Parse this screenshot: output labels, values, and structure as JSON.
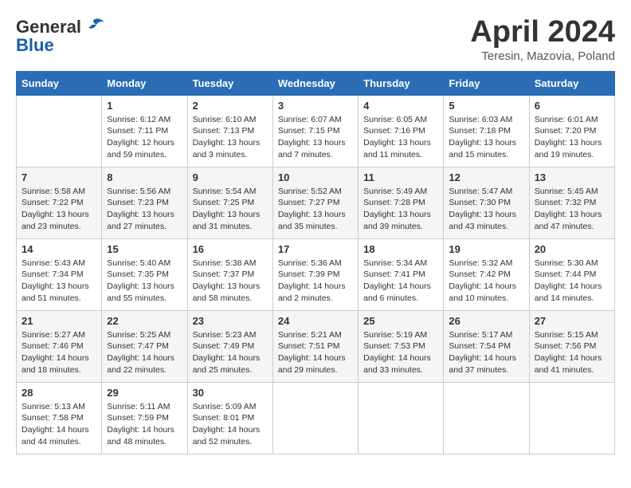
{
  "header": {
    "logo_line1": "General",
    "logo_line2": "Blue",
    "month_year": "April 2024",
    "location": "Teresin, Mazovia, Poland"
  },
  "days_of_week": [
    "Sunday",
    "Monday",
    "Tuesday",
    "Wednesday",
    "Thursday",
    "Friday",
    "Saturday"
  ],
  "weeks": [
    [
      {
        "day": "",
        "info": ""
      },
      {
        "day": "1",
        "info": "Sunrise: 6:12 AM\nSunset: 7:11 PM\nDaylight: 12 hours\nand 59 minutes."
      },
      {
        "day": "2",
        "info": "Sunrise: 6:10 AM\nSunset: 7:13 PM\nDaylight: 13 hours\nand 3 minutes."
      },
      {
        "day": "3",
        "info": "Sunrise: 6:07 AM\nSunset: 7:15 PM\nDaylight: 13 hours\nand 7 minutes."
      },
      {
        "day": "4",
        "info": "Sunrise: 6:05 AM\nSunset: 7:16 PM\nDaylight: 13 hours\nand 11 minutes."
      },
      {
        "day": "5",
        "info": "Sunrise: 6:03 AM\nSunset: 7:18 PM\nDaylight: 13 hours\nand 15 minutes."
      },
      {
        "day": "6",
        "info": "Sunrise: 6:01 AM\nSunset: 7:20 PM\nDaylight: 13 hours\nand 19 minutes."
      }
    ],
    [
      {
        "day": "7",
        "info": "Sunrise: 5:58 AM\nSunset: 7:22 PM\nDaylight: 13 hours\nand 23 minutes."
      },
      {
        "day": "8",
        "info": "Sunrise: 5:56 AM\nSunset: 7:23 PM\nDaylight: 13 hours\nand 27 minutes."
      },
      {
        "day": "9",
        "info": "Sunrise: 5:54 AM\nSunset: 7:25 PM\nDaylight: 13 hours\nand 31 minutes."
      },
      {
        "day": "10",
        "info": "Sunrise: 5:52 AM\nSunset: 7:27 PM\nDaylight: 13 hours\nand 35 minutes."
      },
      {
        "day": "11",
        "info": "Sunrise: 5:49 AM\nSunset: 7:28 PM\nDaylight: 13 hours\nand 39 minutes."
      },
      {
        "day": "12",
        "info": "Sunrise: 5:47 AM\nSunset: 7:30 PM\nDaylight: 13 hours\nand 43 minutes."
      },
      {
        "day": "13",
        "info": "Sunrise: 5:45 AM\nSunset: 7:32 PM\nDaylight: 13 hours\nand 47 minutes."
      }
    ],
    [
      {
        "day": "14",
        "info": "Sunrise: 5:43 AM\nSunset: 7:34 PM\nDaylight: 13 hours\nand 51 minutes."
      },
      {
        "day": "15",
        "info": "Sunrise: 5:40 AM\nSunset: 7:35 PM\nDaylight: 13 hours\nand 55 minutes."
      },
      {
        "day": "16",
        "info": "Sunrise: 5:38 AM\nSunset: 7:37 PM\nDaylight: 13 hours\nand 58 minutes."
      },
      {
        "day": "17",
        "info": "Sunrise: 5:36 AM\nSunset: 7:39 PM\nDaylight: 14 hours\nand 2 minutes."
      },
      {
        "day": "18",
        "info": "Sunrise: 5:34 AM\nSunset: 7:41 PM\nDaylight: 14 hours\nand 6 minutes."
      },
      {
        "day": "19",
        "info": "Sunrise: 5:32 AM\nSunset: 7:42 PM\nDaylight: 14 hours\nand 10 minutes."
      },
      {
        "day": "20",
        "info": "Sunrise: 5:30 AM\nSunset: 7:44 PM\nDaylight: 14 hours\nand 14 minutes."
      }
    ],
    [
      {
        "day": "21",
        "info": "Sunrise: 5:27 AM\nSunset: 7:46 PM\nDaylight: 14 hours\nand 18 minutes."
      },
      {
        "day": "22",
        "info": "Sunrise: 5:25 AM\nSunset: 7:47 PM\nDaylight: 14 hours\nand 22 minutes."
      },
      {
        "day": "23",
        "info": "Sunrise: 5:23 AM\nSunset: 7:49 PM\nDaylight: 14 hours\nand 25 minutes."
      },
      {
        "day": "24",
        "info": "Sunrise: 5:21 AM\nSunset: 7:51 PM\nDaylight: 14 hours\nand 29 minutes."
      },
      {
        "day": "25",
        "info": "Sunrise: 5:19 AM\nSunset: 7:53 PM\nDaylight: 14 hours\nand 33 minutes."
      },
      {
        "day": "26",
        "info": "Sunrise: 5:17 AM\nSunset: 7:54 PM\nDaylight: 14 hours\nand 37 minutes."
      },
      {
        "day": "27",
        "info": "Sunrise: 5:15 AM\nSunset: 7:56 PM\nDaylight: 14 hours\nand 41 minutes."
      }
    ],
    [
      {
        "day": "28",
        "info": "Sunrise: 5:13 AM\nSunset: 7:58 PM\nDaylight: 14 hours\nand 44 minutes."
      },
      {
        "day": "29",
        "info": "Sunrise: 5:11 AM\nSunset: 7:59 PM\nDaylight: 14 hours\nand 48 minutes."
      },
      {
        "day": "30",
        "info": "Sunrise: 5:09 AM\nSunset: 8:01 PM\nDaylight: 14 hours\nand 52 minutes."
      },
      {
        "day": "",
        "info": ""
      },
      {
        "day": "",
        "info": ""
      },
      {
        "day": "",
        "info": ""
      },
      {
        "day": "",
        "info": ""
      }
    ]
  ]
}
